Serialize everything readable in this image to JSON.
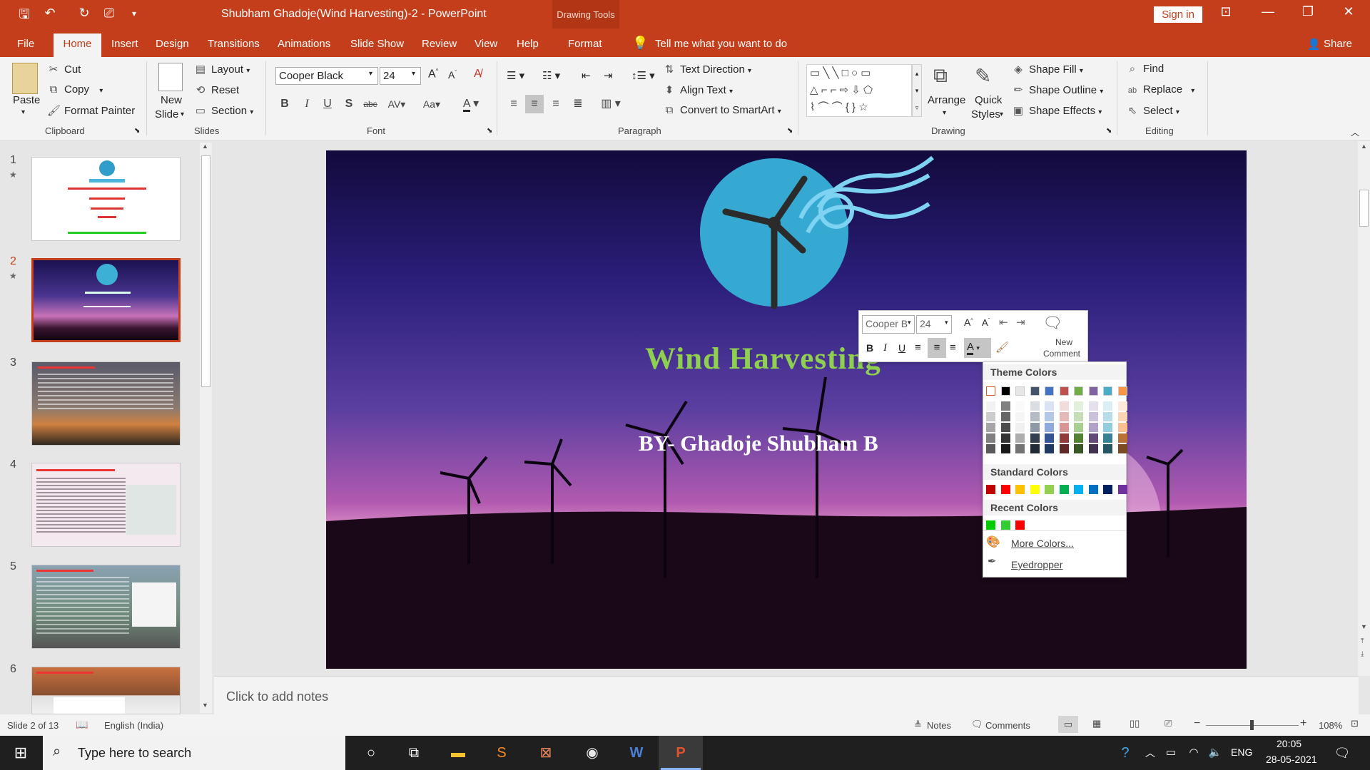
{
  "titlebar": {
    "doc_title": "Shubham Ghadoje(Wind Harvesting)-2  -  PowerPoint",
    "context_tab": "Drawing Tools",
    "sign_in": "Sign in",
    "minimize": "—",
    "restore": "❐",
    "close": "✕"
  },
  "menu": {
    "tabs": [
      "File",
      "Home",
      "Insert",
      "Design",
      "Transitions",
      "Animations",
      "Slide Show",
      "Review",
      "View",
      "Help",
      "Format"
    ],
    "tell_me": "Tell me what you want to do",
    "share": "Share"
  },
  "ribbon": {
    "clipboard": {
      "paste": "Paste",
      "cut": "Cut",
      "copy": "Copy",
      "format_painter": "Format Painter",
      "label": "Clipboard"
    },
    "slides": {
      "new_slide_1": "New",
      "new_slide_2": "Slide",
      "layout": "Layout",
      "reset": "Reset",
      "section": "Section",
      "label": "Slides"
    },
    "font": {
      "name": "Cooper Black",
      "size": "24",
      "label": "Font"
    },
    "paragraph": {
      "text_direction": "Text Direction",
      "align_text": "Align Text",
      "convert_smartart": "Convert to SmartArt",
      "label": "Paragraph"
    },
    "drawing": {
      "arrange": "Arrange",
      "quick_styles_1": "Quick",
      "quick_styles_2": "Styles",
      "shape_fill": "Shape Fill",
      "shape_outline": "Shape Outline",
      "shape_effects": "Shape Effects",
      "label": "Drawing"
    },
    "editing": {
      "find": "Find",
      "replace": "Replace",
      "select": "Select",
      "label": "Editing"
    }
  },
  "thumbnails": [
    {
      "num": "1",
      "star": "★"
    },
    {
      "num": "2",
      "star": "★"
    },
    {
      "num": "3",
      "star": ""
    },
    {
      "num": "4",
      "star": ""
    },
    {
      "num": "5",
      "star": ""
    },
    {
      "num": "6",
      "star": ""
    }
  ],
  "slide": {
    "title": "Wind Harvesting",
    "author": "BY- Ghadoje Shubham B"
  },
  "mini_toolbar": {
    "font_name": "Cooper B",
    "font_size": "24",
    "new_comment_1": "New",
    "new_comment_2": "Comment"
  },
  "color_popup": {
    "theme_colors": "Theme Colors",
    "standard_colors": "Standard Colors",
    "recent_colors": "Recent Colors",
    "more_colors": "More Colors...",
    "eyedropper": "Eyedropper",
    "theme_row": [
      "#ffffff",
      "#000000",
      "#e7e6e6",
      "#44546a",
      "#4472c4",
      "#c0504d",
      "#70ad47",
      "#8064a2",
      "#4bacc6",
      "#f79646"
    ],
    "standard_row": [
      "#c00000",
      "#ff0000",
      "#ffc000",
      "#ffff00",
      "#92d050",
      "#00b050",
      "#00b0f0",
      "#0070c0",
      "#002060",
      "#7030a0"
    ],
    "recent_row": [
      "#00cc00",
      "#33cc33",
      "#ff0000"
    ]
  },
  "notes": {
    "placeholder": "Click to add notes"
  },
  "statusbar": {
    "slide_of": "Slide 2 of 13",
    "language": "English (India)",
    "notes": "Notes",
    "comments": "Comments",
    "zoom": "108%"
  },
  "taskbar": {
    "search_placeholder": "Type here to search",
    "lang": "ENG",
    "time": "20:05",
    "date": "28-05-2021"
  }
}
